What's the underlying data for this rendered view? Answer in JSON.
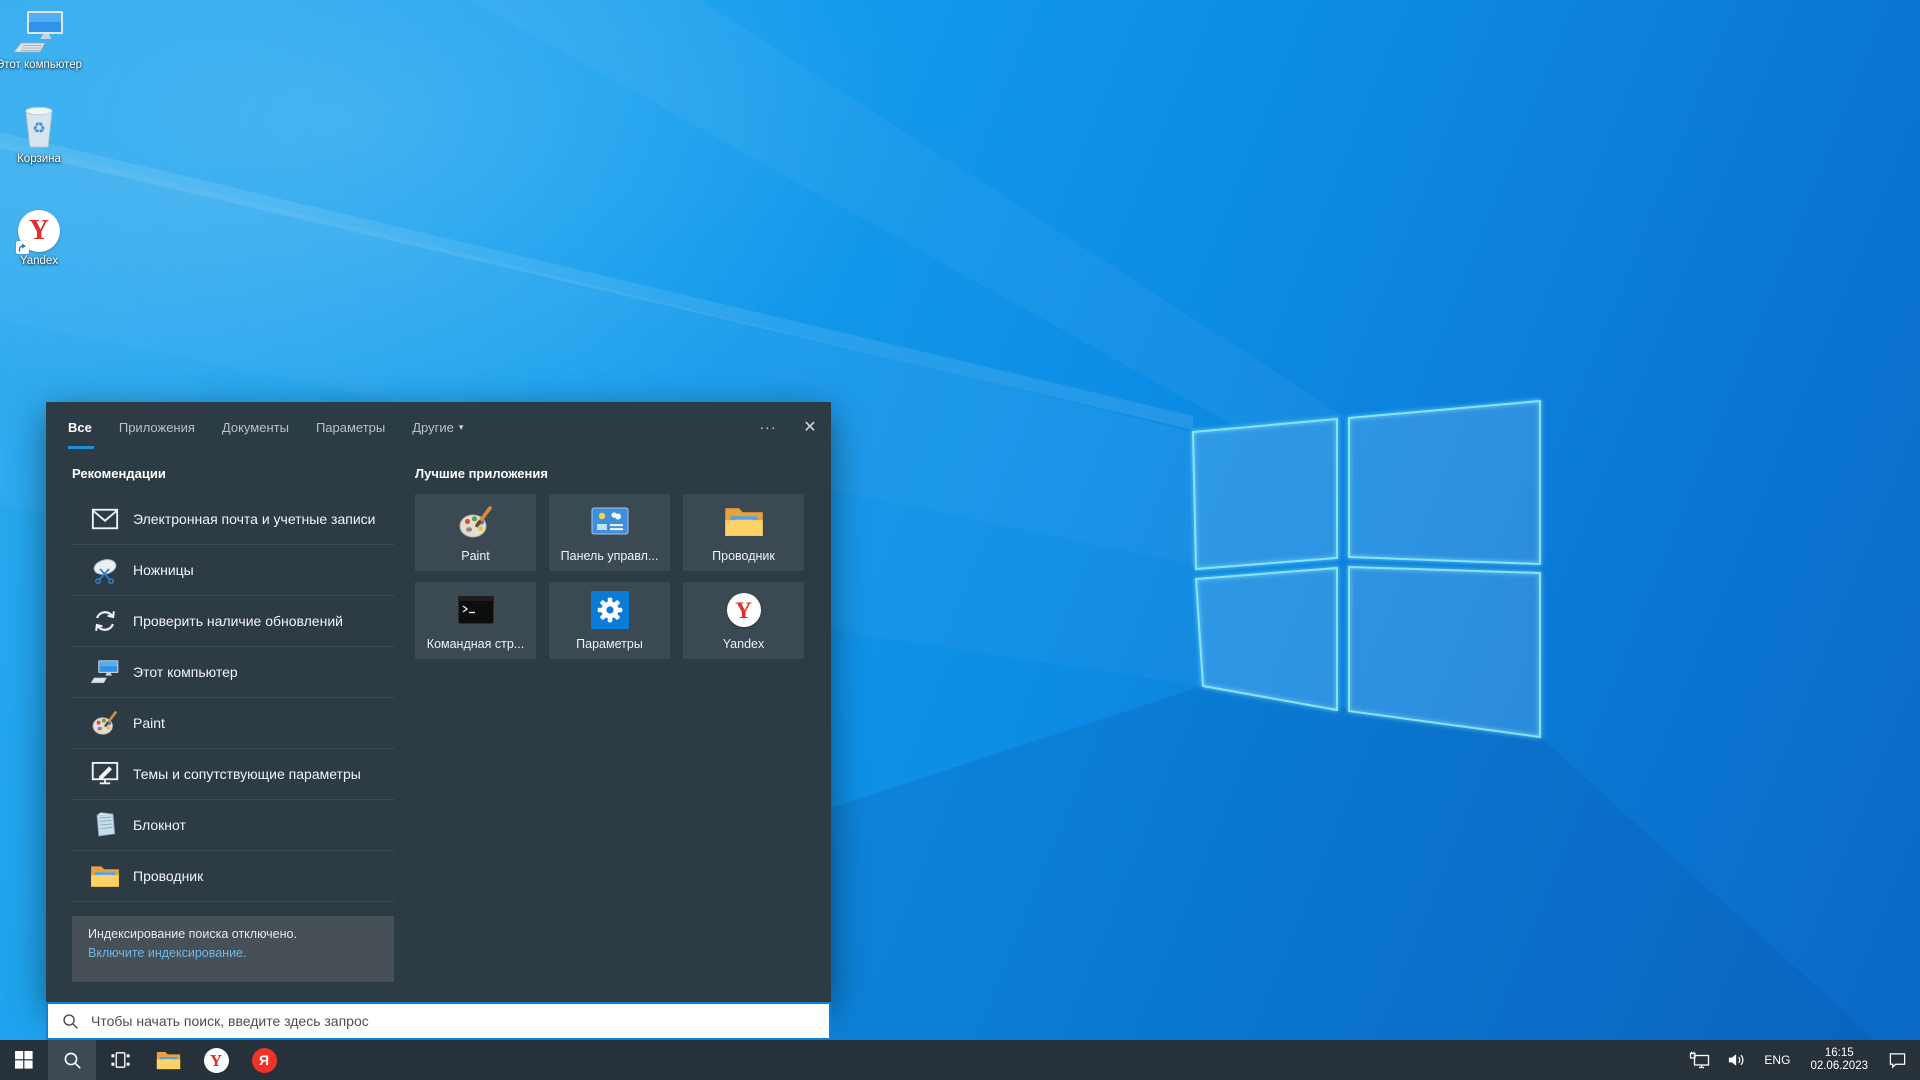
{
  "desktop": {
    "icons": [
      {
        "name": "this-pc",
        "label": "Этот компьютер"
      },
      {
        "name": "recycle-bin",
        "label": "Корзина"
      },
      {
        "name": "yandex",
        "label": "Yandex"
      }
    ]
  },
  "search_panel": {
    "tabs": [
      {
        "label": "Все",
        "active": true
      },
      {
        "label": "Приложения"
      },
      {
        "label": "Документы"
      },
      {
        "label": "Параметры"
      },
      {
        "label": "Другие",
        "has_caret": true
      }
    ],
    "controls": {
      "more": "···",
      "close": "✕",
      "caret": "▾"
    },
    "recommendations": {
      "title": "Рекомендации",
      "items": [
        {
          "icon": "mail-icon",
          "label": "Электронная почта и учетные записи"
        },
        {
          "icon": "snipping-tool-icon",
          "label": "Ножницы"
        },
        {
          "icon": "update-icon",
          "label": "Проверить наличие обновлений"
        },
        {
          "icon": "this-pc-icon",
          "label": "Этот компьютер"
        },
        {
          "icon": "paint-icon",
          "label": "Paint"
        },
        {
          "icon": "themes-icon",
          "label": "Темы и сопутствующие параметры"
        },
        {
          "icon": "notepad-icon",
          "label": "Блокнот"
        },
        {
          "icon": "explorer-icon",
          "label": "Проводник"
        }
      ]
    },
    "top_apps": {
      "title": "Лучшие приложения",
      "tiles": [
        {
          "icon": "paint-icon",
          "label": "Paint"
        },
        {
          "icon": "control-panel-icon",
          "label": "Панель управл..."
        },
        {
          "icon": "explorer-icon",
          "label": "Проводник"
        },
        {
          "icon": "cmd-icon",
          "label": "Командная стр..."
        },
        {
          "icon": "settings-icon",
          "label": "Параметры"
        },
        {
          "icon": "yandex-icon",
          "label": "Yandex"
        }
      ]
    },
    "notice": {
      "text": "Индексирование поиска отключено.",
      "link_text": "Включите индексирование."
    },
    "search_input": {
      "placeholder": "Чтобы начать поиск, введите здесь запрос"
    }
  },
  "taskbar": {
    "buttons": [
      "start",
      "search",
      "task-view",
      "file-explorer",
      "yandex-browser",
      "yandex"
    ],
    "tray": {
      "language": "ENG",
      "time": "16:15",
      "date": "02.06.2023"
    }
  },
  "branding": {
    "yandex_letter": "Y",
    "yandex_ru_letter": "Я"
  },
  "colors": {
    "accent": "#0d80d8",
    "panel_bg": "#2d3b44",
    "tile_bg": "#3b4953",
    "notice_bg": "#474f57",
    "taskbar_bg": "#26313a",
    "link": "#6cb8ec",
    "wallpaper_top": "#2fabef",
    "wallpaper_bottom": "#0968c4"
  }
}
